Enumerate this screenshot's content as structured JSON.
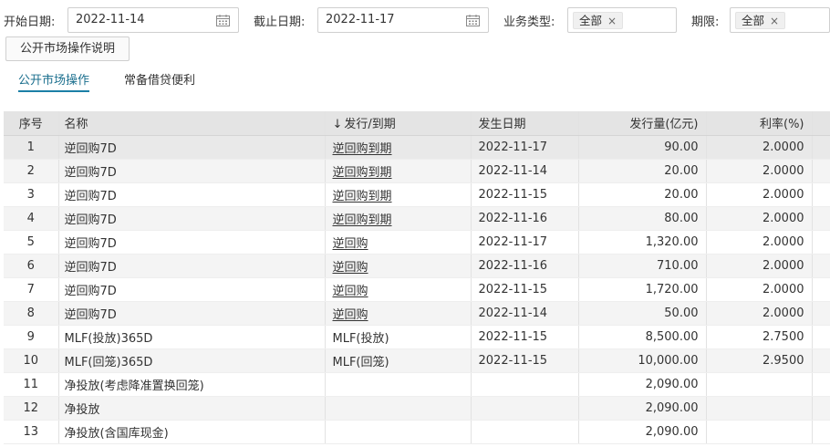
{
  "filters": {
    "start_label": "开始日期:",
    "start_value": "2022-11-14",
    "end_label": "截止日期:",
    "end_value": "2022-11-17",
    "biz_type_label": "业务类型:",
    "biz_type_value": "全部",
    "term_label": "期限:",
    "term_value": "全部",
    "remove_glyph": "×"
  },
  "explain_button": "公开市场操作说明",
  "tabs": [
    {
      "label": "公开市场操作",
      "active": true
    },
    {
      "label": "常备借贷便利",
      "active": false
    }
  ],
  "table": {
    "headers": {
      "idx": "序号",
      "name": "名称",
      "sort_arrow": "↓",
      "type": "发行/到期",
      "date": "发生日期",
      "volume": "发行量(亿元)",
      "rate": "利率(%)"
    },
    "rows": [
      {
        "idx": "1",
        "name": "逆回购7D",
        "type": "逆回购到期",
        "type_link": true,
        "date": "2022-11-17",
        "volume": "90.00",
        "rate": "2.0000"
      },
      {
        "idx": "2",
        "name": "逆回购7D",
        "type": "逆回购到期",
        "type_link": true,
        "date": "2022-11-14",
        "volume": "20.00",
        "rate": "2.0000"
      },
      {
        "idx": "3",
        "name": "逆回购7D",
        "type": "逆回购到期",
        "type_link": true,
        "date": "2022-11-15",
        "volume": "20.00",
        "rate": "2.0000"
      },
      {
        "idx": "4",
        "name": "逆回购7D",
        "type": "逆回购到期",
        "type_link": true,
        "date": "2022-11-16",
        "volume": "80.00",
        "rate": "2.0000"
      },
      {
        "idx": "5",
        "name": "逆回购7D",
        "type": "逆回购",
        "type_link": true,
        "date": "2022-11-17",
        "volume": "1,320.00",
        "rate": "2.0000"
      },
      {
        "idx": "6",
        "name": "逆回购7D",
        "type": "逆回购",
        "type_link": true,
        "date": "2022-11-16",
        "volume": "710.00",
        "rate": "2.0000"
      },
      {
        "idx": "7",
        "name": "逆回购7D",
        "type": "逆回购",
        "type_link": true,
        "date": "2022-11-15",
        "volume": "1,720.00",
        "rate": "2.0000"
      },
      {
        "idx": "8",
        "name": "逆回购7D",
        "type": "逆回购",
        "type_link": true,
        "date": "2022-11-14",
        "volume": "50.00",
        "rate": "2.0000"
      },
      {
        "idx": "9",
        "name": "MLF(投放)365D",
        "type": "MLF(投放)",
        "type_link": false,
        "date": "2022-11-15",
        "volume": "8,500.00",
        "rate": "2.7500"
      },
      {
        "idx": "10",
        "name": "MLF(回笼)365D",
        "type": "MLF(回笼)",
        "type_link": false,
        "date": "2022-11-15",
        "volume": "10,000.00",
        "rate": "2.9500"
      },
      {
        "idx": "11",
        "name": "净投放(考虑降准置换回笼)",
        "type": "",
        "type_link": false,
        "date": "",
        "volume": "2,090.00",
        "rate": ""
      },
      {
        "idx": "12",
        "name": "净投放",
        "type": "",
        "type_link": false,
        "date": "",
        "volume": "2,090.00",
        "rate": ""
      },
      {
        "idx": "13",
        "name": "净投放(含国库现金)",
        "type": "",
        "type_link": false,
        "date": "",
        "volume": "2,090.00",
        "rate": ""
      }
    ]
  },
  "colors": {
    "accent": "#1b7fa6",
    "header_bg": "#e4e4e4",
    "row_alt_bg": "#f4f4f4"
  },
  "icons": {
    "date_picker": "calendar-icon",
    "tag_remove": "close-icon",
    "sort": "arrow-down-icon"
  }
}
